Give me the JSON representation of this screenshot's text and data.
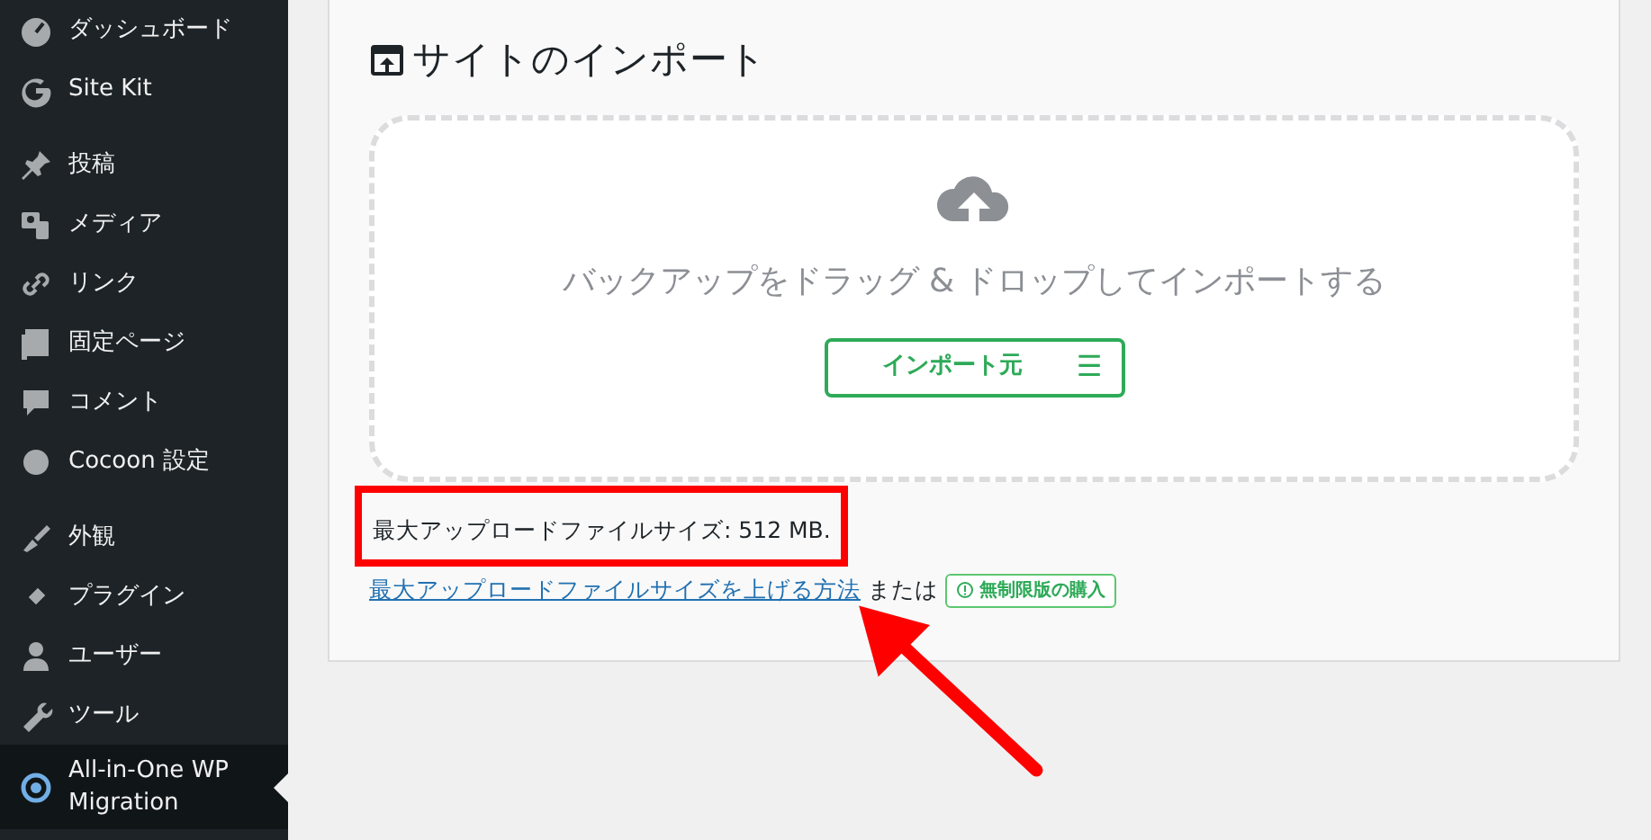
{
  "sidebar": {
    "groups": [
      {
        "items": [
          {
            "label": "ダッシュボード",
            "selected": false
          },
          {
            "label": "Site Kit",
            "selected": false
          }
        ]
      },
      {
        "items": [
          {
            "label": "投稿",
            "selected": false
          },
          {
            "label": "メディア",
            "selected": false
          },
          {
            "label": "リンク",
            "selected": false
          },
          {
            "label": "固定ページ",
            "selected": false
          },
          {
            "label": "コメント",
            "selected": false
          },
          {
            "label": "Cocoon 設定",
            "selected": false
          }
        ]
      },
      {
        "items": [
          {
            "label": "外観",
            "selected": false
          },
          {
            "label": "プラグイン",
            "selected": false
          },
          {
            "label": "ユーザー",
            "selected": false
          },
          {
            "label": "ツール",
            "selected": false
          },
          {
            "label": "All-in-One WP Migration",
            "selected": true
          }
        ]
      }
    ]
  },
  "import": {
    "title": "サイトのインポート",
    "drop_hint": "バックアップをドラッグ & ドロップしてインポートする",
    "import_button": "インポート元",
    "menu_glyph": "☰",
    "upload_limit": {
      "text": "最大アップロードファイルサイズ: 512 MB.",
      "highlighted": true
    },
    "help_link": "最大アップロードファイルサイズを上げる方法",
    "or_text": "または",
    "buy_badge": "無制限版の購入"
  }
}
